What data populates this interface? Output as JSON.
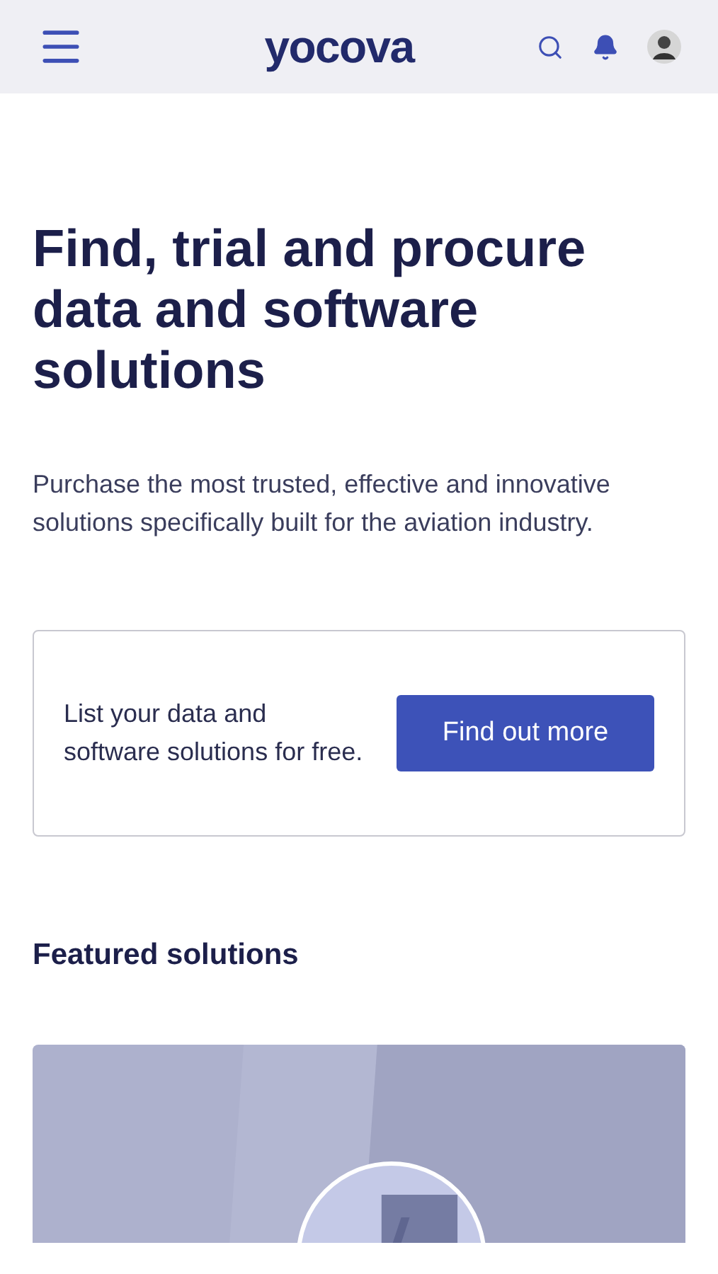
{
  "header": {
    "logo": "yocova"
  },
  "hero": {
    "title": "Find, trial and procure data and software solutions",
    "text": "Purchase the most trusted, effective and innovative solutions specifically built for the aviation industry."
  },
  "promo": {
    "text": "List your data and software solutions for free.",
    "button": "Find out more"
  },
  "featured": {
    "title": "Featured solutions"
  }
}
